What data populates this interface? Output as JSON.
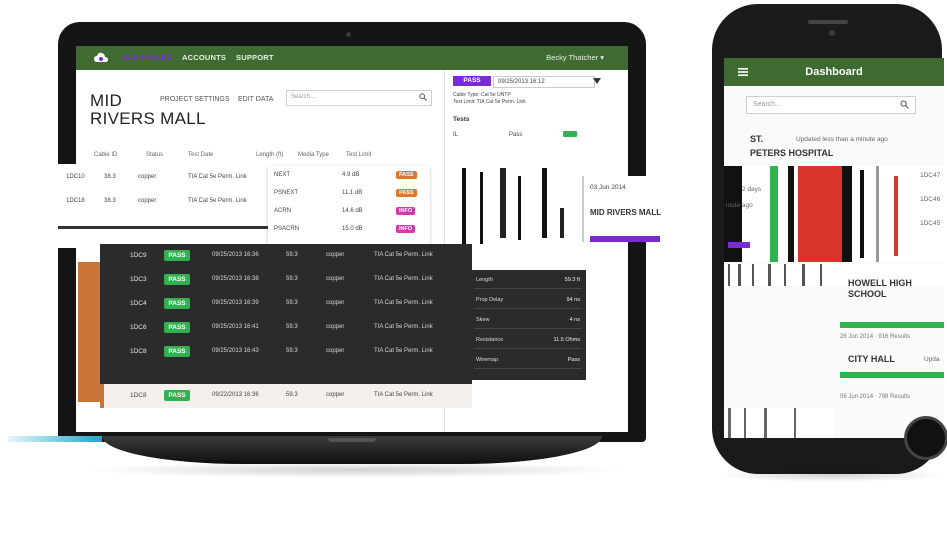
{
  "laptop": {
    "nav": {
      "items": [
        "DASHBOARD",
        "ACCOUNTS",
        "SUPPORT"
      ],
      "user": "Becky Thatcher ▾"
    },
    "project": {
      "title_line1": "MID",
      "title_line2": "RIVERS MALL",
      "links": [
        "PROJECT SETTINGS",
        "EDIT DATA"
      ],
      "search_placeholder": "Search..."
    },
    "table": {
      "columns": [
        "Cable ID",
        "Status",
        "Test Date",
        "Length (ft)",
        "Media Type",
        "Test Limit"
      ],
      "rows": [
        {
          "id": "1DC10",
          "status": "38.3",
          "media": "copper",
          "limit": "TIA Cat 5e Perm. Link"
        },
        {
          "id": "1DC18",
          "status": "38.3",
          "media": "copper",
          "limit": "TIA Cat 5e Perm. Link"
        }
      ]
    },
    "test_popup": {
      "rows": [
        {
          "label": "NEXT",
          "value": "4.9 dB",
          "badge": "PASS"
        },
        {
          "label": "PSNEXT",
          "value": "11.1 dB",
          "badge": "PASS"
        },
        {
          "label": "ACRN",
          "value": "14.6 dB",
          "badge": "INFO"
        },
        {
          "label": "PSACRN",
          "value": "15.0 dB",
          "badge": "INFO"
        }
      ]
    },
    "side": {
      "pass_label": "PASS",
      "date": "09/25/2013 16:12",
      "cable_type": "Cable Type: Cat 5e UNTP",
      "test_limit": "Test Limit: TIA Cat 5e Perm. Link",
      "tests_title": "Tests",
      "test_row": {
        "name": "IL",
        "result": "Pass"
      }
    },
    "dark_rows": [
      {
        "id": "1DC9",
        "status": "PASS",
        "date": "09/25/2013 16:36",
        "len": "59.3",
        "media": "copper",
        "limit": "TIA Cat 5e Perm. Link"
      },
      {
        "id": "1DC3",
        "status": "PASS",
        "date": "09/25/2013 16:38",
        "len": "59.3",
        "media": "copper",
        "limit": "TIA Cat 5e Perm. Link"
      },
      {
        "id": "1DC4",
        "status": "PASS",
        "date": "09/25/2013 16:39",
        "len": "59.3",
        "media": "copper",
        "limit": "TIA Cat 5e Perm. Link"
      },
      {
        "id": "1DC6",
        "status": "PASS",
        "date": "09/25/2013 16:41",
        "len": "59.3",
        "media": "copper",
        "limit": "TIA Cat 5e Perm. Link"
      },
      {
        "id": "1DC8",
        "status": "PASS",
        "date": "09/25/2013 16:43",
        "len": "59.3",
        "media": "copper",
        "limit": "TIA Cat 5e Perm. Link"
      }
    ],
    "light_row": {
      "id": "1DC8",
      "status": "PASS",
      "date": "09/22/2013 16:36",
      "len": "59.3",
      "media": "copper",
      "limit": "TIA Cat 5e Perm. Link"
    },
    "side_table": [
      {
        "label": "Length",
        "value": "59.3 ft"
      },
      {
        "label": "Prop Delay",
        "value": "94 ns"
      },
      {
        "label": "Skew",
        "value": "4 ns"
      },
      {
        "label": "Resistance",
        "value": "11.5 Ohms"
      },
      {
        "label": "Wiremap",
        "value": "Pass"
      }
    ],
    "mid_card": {
      "date": "03 Jun 2014",
      "title": "MID RIVERS MALL"
    }
  },
  "phone": {
    "title": "Dashboard",
    "search_placeholder": "Search...",
    "card1": {
      "title_line1": "ST.",
      "title_line2": "PETERS HOSPITAL",
      "updated": "Updated less than a minute ago"
    },
    "left_snips": [
      "2 days",
      "inute ago"
    ],
    "right_snips": [
      "1DC47",
      "1DC46",
      "1DC45"
    ],
    "card2": {
      "title_line1": "HOWELL HIGH",
      "title_line2": "SCHOOL",
      "date": "26 Jun 2014 · 916 Results"
    },
    "card3": {
      "title": "CITY HALL",
      "updated": "Upda",
      "date": "06 Jun 2014 · 798 Results"
    }
  },
  "colors": {
    "nav_green": "#3f6b32",
    "purple": "#7b2bd4",
    "pass_green": "#2fb34e",
    "warn_orange": "#e2772a",
    "info_pink": "#d23aa8",
    "red": "#d9342b"
  }
}
